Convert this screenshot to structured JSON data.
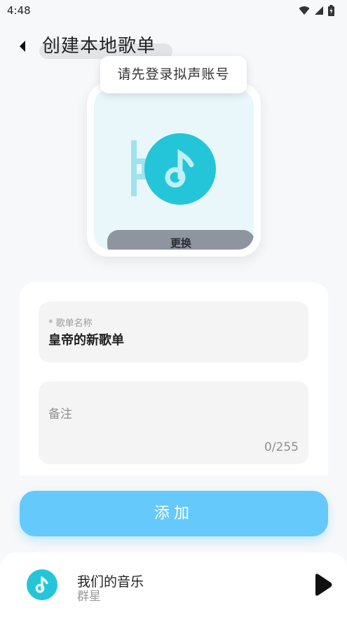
{
  "status_bar": {
    "time": "4:48"
  },
  "header": {
    "title": "创建本地歌单"
  },
  "toast": {
    "text": "请先登录拟声账号"
  },
  "cover": {
    "change_label": "更换"
  },
  "form": {
    "name_label": "* 歌单名称",
    "name_value": "皇帝的新歌单",
    "remark_placeholder": "备注",
    "remark_counter": "0/255"
  },
  "actions": {
    "add_label": "添加"
  },
  "player": {
    "song": "我们的音乐",
    "artist": "群星"
  },
  "colors": {
    "accent": "#25c5d9",
    "button": "#65c9fb",
    "background": "#f7f8fa"
  },
  "icons": {
    "back": "back-arrow-icon",
    "music_note": "music-note-icon",
    "play": "play-icon",
    "wifi": "wifi-icon",
    "signal": "signal-icon",
    "battery": "battery-icon"
  }
}
